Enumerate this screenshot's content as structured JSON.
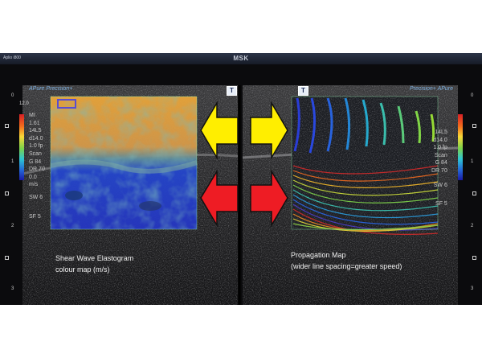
{
  "header": {
    "device": "Aplio i800",
    "mode": "MSK"
  },
  "left_panel": {
    "brand": "APure Precision+",
    "t_marker": "T",
    "params": [
      "MI",
      "1.61",
      "14L5",
      "d14.0",
      "1.0 fp",
      "Scan",
      "G 84",
      "DR 70",
      "0.0",
      "m/s",
      "SW 6",
      "SF 5"
    ],
    "scale_max": "12.0",
    "caption_line1": "Shear Wave Elastogram",
    "caption_line2": "colour map (m/s)",
    "depth_labels": [
      "0",
      "1",
      "2",
      "3"
    ]
  },
  "right_panel": {
    "brand": "Precision+ APure",
    "t_marker": "T",
    "params": [
      "14L5",
      "d14.0",
      "1.0 fp",
      "Scan",
      "G 84",
      "DR 70",
      "SW 6",
      "SF 5"
    ],
    "caption_line1": "Propagation Map",
    "caption_line2": "(wider line spacing=greater speed)",
    "depth_labels": [
      "0",
      "1",
      "2",
      "3"
    ]
  },
  "arrows": {
    "top_color": "#ffee00",
    "bottom_color": "#ee1c24"
  },
  "colors": {
    "background": "#0b0b0d",
    "roi_stiff": "#f3a33b",
    "roi_soft": "#2743c9"
  }
}
